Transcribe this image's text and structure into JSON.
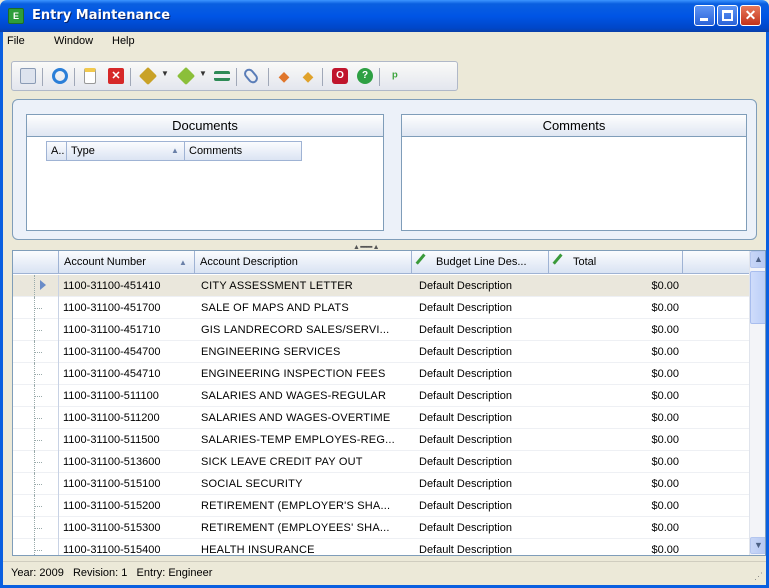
{
  "window": {
    "title": "Entry Maintenance",
    "icon_label": "E"
  },
  "menu": [
    "File",
    "Window",
    "Help"
  ],
  "toolbar": {
    "tools": [
      {
        "name": "save-icon",
        "color": "#8a9bb5"
      },
      {
        "name": "refresh-icon",
        "color": "#2b7fd8"
      },
      {
        "name": "new-document-icon",
        "color": "#f2c94c"
      },
      {
        "name": "delete-icon",
        "color": "#d62828"
      },
      {
        "name": "package-icon",
        "color": "#c9a227"
      },
      {
        "name": "package-2-icon",
        "color": "#c9a227"
      },
      {
        "name": "flow-icon",
        "color": "#2e8b57"
      },
      {
        "name": "attach-icon",
        "color": "#5a7db8"
      },
      {
        "name": "arrow-up-icon",
        "color": "#e0762b"
      },
      {
        "name": "arrow-down-icon",
        "color": "#e0a22b"
      },
      {
        "name": "stop-icon",
        "color": "#c0152c"
      },
      {
        "name": "help-icon",
        "color": "#2ea043"
      },
      {
        "name": "tip-icon",
        "color": "#3fa53f"
      }
    ]
  },
  "documents_panel": {
    "title": "Documents",
    "columns": [
      "A..",
      "Type",
      "Comments"
    ]
  },
  "comments_panel": {
    "title": "Comments"
  },
  "grid": {
    "columns": {
      "account_number": "Account Number",
      "account_description": "Account Description",
      "budget_line_description": "Budget Line Des...",
      "total": "Total"
    },
    "rows": [
      {
        "account": "1100-31100-451410",
        "description": "CITY ASSESSMENT LETTER",
        "budget": "Default Description",
        "total": "$0.00",
        "selected": true
      },
      {
        "account": "1100-31100-451700",
        "description": "SALE OF MAPS AND PLATS",
        "budget": "Default Description",
        "total": "$0.00"
      },
      {
        "account": "1100-31100-451710",
        "description": "GIS LANDRECORD SALES/SERVI...",
        "budget": "Default Description",
        "total": "$0.00"
      },
      {
        "account": "1100-31100-454700",
        "description": "ENGINEERING SERVICES",
        "budget": "Default Description",
        "total": "$0.00"
      },
      {
        "account": "1100-31100-454710",
        "description": "ENGINEERING INSPECTION FEES",
        "budget": "Default Description",
        "total": "$0.00"
      },
      {
        "account": "1100-31100-511100",
        "description": "SALARIES AND WAGES-REGULAR",
        "budget": "Default Description",
        "total": "$0.00"
      },
      {
        "account": "1100-31100-511200",
        "description": "SALARIES AND WAGES-OVERTIME",
        "budget": "Default Description",
        "total": "$0.00"
      },
      {
        "account": "1100-31100-511500",
        "description": "SALARIES-TEMP EMPLOYES-REG...",
        "budget": "Default Description",
        "total": "$0.00"
      },
      {
        "account": "1100-31100-513600",
        "description": "SICK LEAVE CREDIT PAY OUT",
        "budget": "Default Description",
        "total": "$0.00"
      },
      {
        "account": "1100-31100-515100",
        "description": "SOCIAL SECURITY",
        "budget": "Default Description",
        "total": "$0.00"
      },
      {
        "account": "1100-31100-515200",
        "description": "RETIREMENT (EMPLOYER'S SHA...",
        "budget": "Default Description",
        "total": "$0.00"
      },
      {
        "account": "1100-31100-515300",
        "description": "RETIREMENT (EMPLOYEES' SHA...",
        "budget": "Default Description",
        "total": "$0.00"
      },
      {
        "account": "1100-31100-515400",
        "description": "HEALTH INSURANCE",
        "budget": "Default Description",
        "total": "$0.00"
      }
    ]
  },
  "status": {
    "text": "Year: 2009   Revision: 1   Entry: Engineer"
  }
}
